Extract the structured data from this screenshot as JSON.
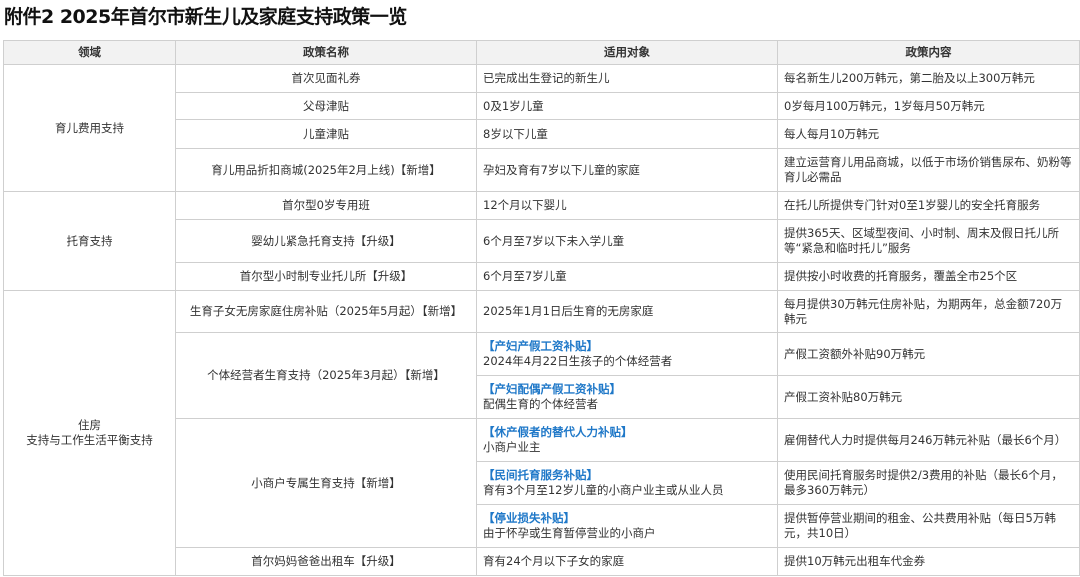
{
  "title": "附件2 2025年首尔市新生儿及家庭支持政策一览",
  "headers": [
    "领域",
    "政策名称",
    "适用对象",
    "政策内容"
  ],
  "domains": {
    "childcare_cost": "育儿费用支持",
    "childcare": "托育支持",
    "housing_line1": "住房",
    "housing_line2": "支持与工作生活平衡支持"
  },
  "rows": [
    {
      "policy": "首次见面礼券",
      "target": "已完成出生登记的新生儿",
      "content": "每名新生儿200万韩元，第二胎及以上300万韩元"
    },
    {
      "policy": "父母津贴",
      "target": "0及1岁儿童",
      "content": "0岁每月100万韩元，1岁每月50万韩元"
    },
    {
      "policy": "儿童津贴",
      "target": "8岁以下儿童",
      "content": "每人每月10万韩元"
    },
    {
      "policy": "育儿用品折扣商城(2025年2月上线)【新增】",
      "target": "孕妇及育有7岁以下儿童的家庭",
      "content": "建立运营育儿用品商城，以低于市场价销售尿布、奶粉等育儿必需品"
    },
    {
      "policy": "首尔型0岁专用班",
      "target": "12个月以下婴儿",
      "content": "在托儿所提供专门针对0至1岁婴儿的安全托育服务"
    },
    {
      "policy": "婴幼儿紧急托育支持【升级】",
      "target": "6个月至7岁以下未入学儿童",
      "content": "提供365天、区域型夜间、小时制、周末及假日托儿所等“紧急和临时托儿”服务"
    },
    {
      "policy": "首尔型小时制专业托儿所【升级】",
      "target": "6个月至7岁儿童",
      "content": "提供按小时收费的托育服务，覆盖全市25个区"
    },
    {
      "policy": "生育子女无房家庭住房补贴（2025年5月起）【新增】",
      "target": "2025年1月1日后生育的无房家庭",
      "content": "每月提供30万韩元住房补贴，为期两年，总金额720万韩元"
    },
    {
      "policy": "个体经营者生育支持（2025年3月起）【新增】",
      "target_title": "【产妇产假工资补贴】",
      "target": "2024年4月22日生孩子的个体经营者",
      "content": "产假工资额外补贴90万韩元"
    },
    {
      "target_title": "【产妇配偶产假工资补贴】",
      "target": "配偶生育的个体经营者",
      "content": "产假工资补贴80万韩元"
    },
    {
      "policy": "小商户专属生育支持【新增】",
      "target_title": "【休产假者的替代人力补贴】",
      "target": "小商户业主",
      "content": "雇佣替代人力时提供每月246万韩元补贴（最长6个月）"
    },
    {
      "target_title": "【民间托育服务补贴】",
      "target": "育有3个月至12岁儿童的小商户业主或从业人员",
      "content": "使用民间托育服务时提供2/3费用的补贴（最长6个月，最多360万韩元）"
    },
    {
      "target_title": "【停业损失补贴】",
      "target": "由于怀孕或生育暂停营业的小商户",
      "content": "提供暂停营业期间的租金、公共费用补贴（每日5万韩元，共10日）"
    },
    {
      "policy": "首尔妈妈爸爸出租车【升级】",
      "target": "育有24个月以下子女的家庭",
      "content": "提供10万韩元出租车代金券"
    }
  ]
}
